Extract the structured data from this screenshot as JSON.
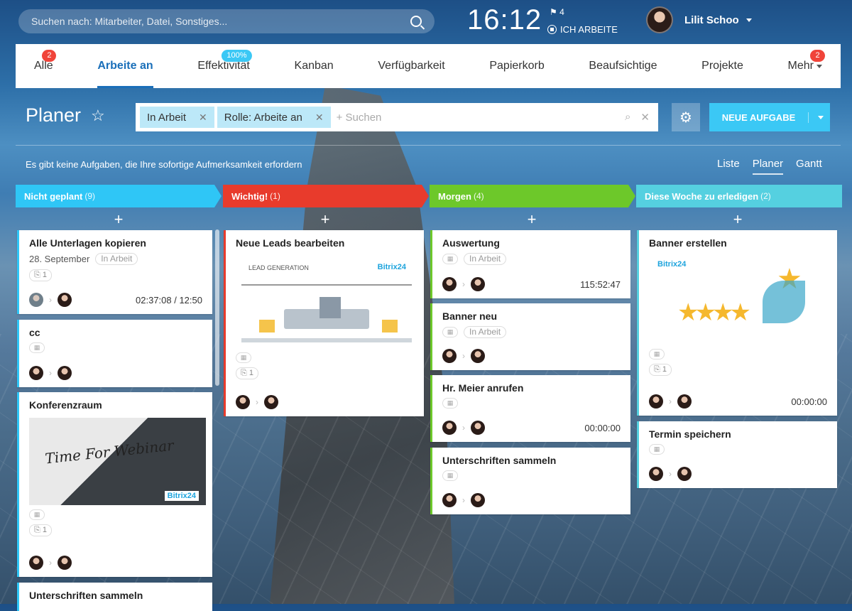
{
  "top": {
    "search_placeholder": "Suchen nach: Mitarbeiter, Datei, Sonstiges...",
    "clock": "16:12",
    "flag_count": "4",
    "work_status": "ICH ARBEITE",
    "user_name": "Lilit Schoo"
  },
  "nav": {
    "tabs": [
      {
        "label": "Alle",
        "badge": "2"
      },
      {
        "label": "Arbeite an",
        "active": true
      },
      {
        "label": "Effektivität",
        "badge": "100%"
      },
      {
        "label": "Kanban"
      },
      {
        "label": "Verfügbarkeit"
      },
      {
        "label": "Papierkorb"
      },
      {
        "label": "Beaufsichtige"
      },
      {
        "label": "Projekte"
      },
      {
        "label": "Mehr",
        "badge": "2"
      }
    ]
  },
  "toolbar": {
    "title": "Planer",
    "chip1": "In Arbeit",
    "chip2": "Rolle: Arbeite an",
    "search_placeholder": "+ Suchen",
    "new_task": "NEUE AUFGABE"
  },
  "notice": "Es gibt keine Aufgaben, die Ihre sofortige Aufmerksamkeit erfordern",
  "views": [
    "Liste",
    "Planer",
    "Gantt"
  ],
  "columns": [
    {
      "title": "Nicht geplant",
      "count": "(9)",
      "color": "#2fc6f6"
    },
    {
      "title": "Wichtig!",
      "count": "(1)",
      "color": "#e83b2c"
    },
    {
      "title": "Morgen",
      "count": "(4)",
      "color": "#6dc82a"
    },
    {
      "title": "Diese Woche zu erledigen",
      "count": "(2)",
      "color": "#55d0e0"
    }
  ],
  "cards": {
    "c1": {
      "title": "Alle Unterlagen kopieren",
      "date": "28. September",
      "status": "In Arbeit",
      "clips": "1",
      "time": "02:37:08 / 12:50"
    },
    "c2": {
      "title": "cc"
    },
    "c3": {
      "title": "Konferenzraum",
      "img_text": "Time For Webinar",
      "brand": "Bitrix24",
      "clips": "1"
    },
    "c4": {
      "title": "Unterschriften sammeln"
    },
    "w1": {
      "title": "Neue Leads bearbeiten",
      "img_text": "LEAD GENERATION",
      "brand": "Bitrix24",
      "clips": "1"
    },
    "m1": {
      "title": "Auswertung",
      "status": "In Arbeit",
      "time": "115:52:47"
    },
    "m2": {
      "title": "Banner neu",
      "status": "In Arbeit"
    },
    "m3": {
      "title": "Hr. Meier anrufen",
      "time": "00:00:00"
    },
    "m4": {
      "title": "Unterschriften sammeln"
    },
    "d1": {
      "title": "Banner erstellen",
      "brand": "Bitrix24",
      "clips": "1",
      "time": "00:00:00"
    },
    "d2": {
      "title": "Termin speichern"
    }
  },
  "colors": {
    "accent": "#3bc8f5",
    "active_tab": "#1a6fb9",
    "badge": "#f0443a"
  }
}
